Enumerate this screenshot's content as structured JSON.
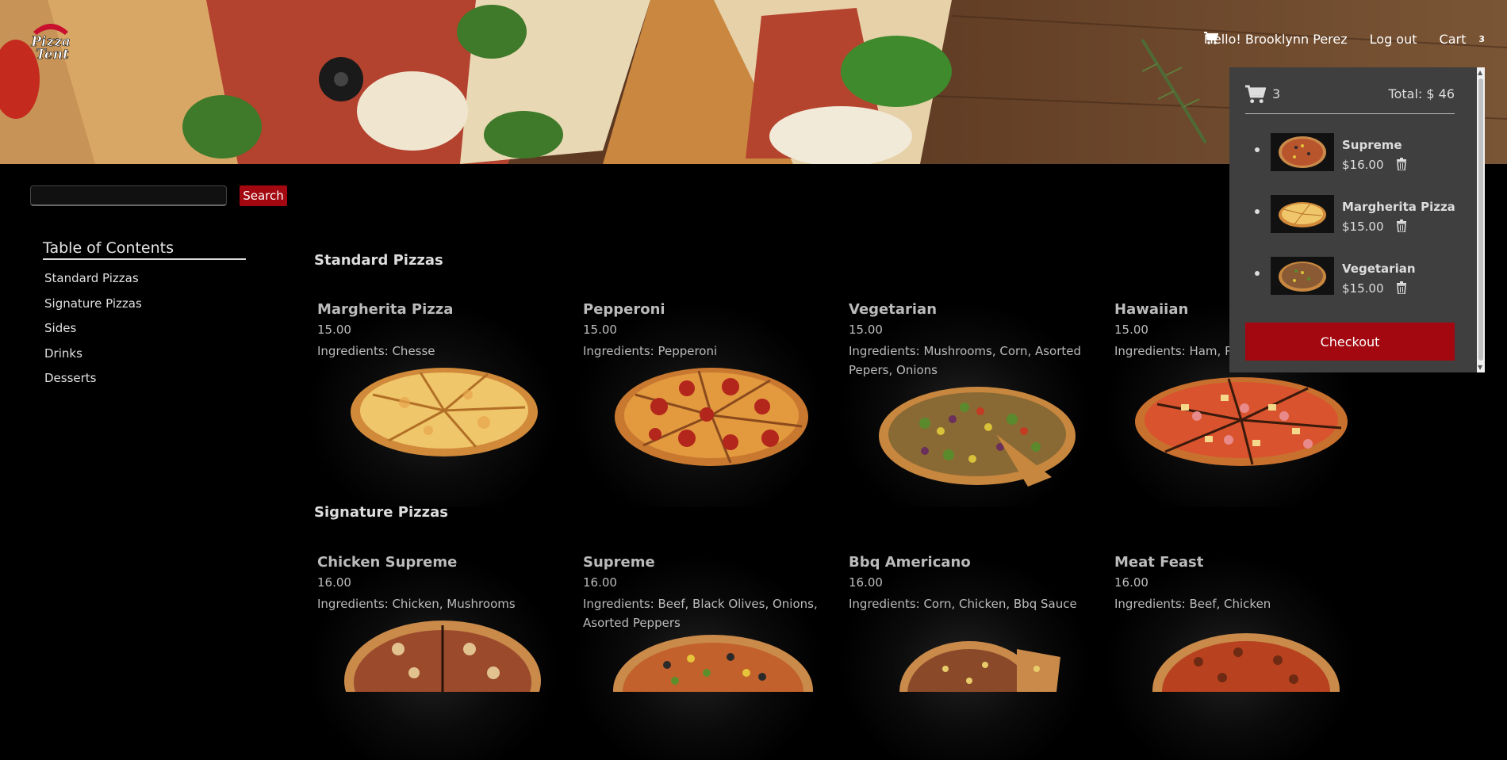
{
  "header": {
    "greeting": "Hello! Brooklynn Perez",
    "logout_label": "Log out",
    "cart_label": "Cart",
    "cart_count": "3",
    "logo_text_1": "Pizza",
    "logo_text_2": "Tent",
    "cart_icon": "cart-icon"
  },
  "search": {
    "placeholder": "",
    "value": "",
    "button_label": "Search"
  },
  "toc": {
    "title": "Table of Contents",
    "items": [
      "Standard Pizzas",
      "Signature Pizzas",
      "Sides",
      "Drinks",
      "Desserts"
    ]
  },
  "menu": {
    "standard": {
      "title": "Standard Pizzas",
      "items": [
        {
          "name": "Margherita Pizza",
          "price": "15.00",
          "ingredients": "Ingredients: Chesse"
        },
        {
          "name": "Pepperoni",
          "price": "15.00",
          "ingredients": "Ingredients: Pepperoni"
        },
        {
          "name": "Vegetarian",
          "price": "15.00",
          "ingredients": "Ingredients: Mushrooms, Corn, Asorted Pepers, Onions"
        },
        {
          "name": "Hawaiian",
          "price": "15.00",
          "ingredients": "Ingredients: Ham, Pi"
        }
      ]
    },
    "signature": {
      "title": "Signature Pizzas",
      "items": [
        {
          "name": "Chicken Supreme",
          "price": "16.00",
          "ingredients": "Ingredients: Chicken, Mushrooms"
        },
        {
          "name": "Supreme",
          "price": "16.00",
          "ingredients": "Ingredients: Beef, Black Olives, Onions, Asorted Peppers"
        },
        {
          "name": "Bbq Americano",
          "price": "16.00",
          "ingredients": "Ingredients: Corn, Chicken, Bbq Sauce"
        },
        {
          "name": "Meat Feast",
          "price": "16.00",
          "ingredients": "Ingredients: Beef, Chicken"
        }
      ]
    }
  },
  "cart": {
    "count": "3",
    "total": "Total: $ 46",
    "items": [
      {
        "name": "Supreme",
        "price": "$16.00"
      },
      {
        "name": "Margherita Pizza",
        "price": "$15.00"
      },
      {
        "name": "Vegetarian",
        "price": "$15.00"
      }
    ],
    "checkout_label": "Checkout"
  },
  "colors": {
    "accent": "#a3070f",
    "background": "#000000",
    "popup": "#3f3f3f"
  }
}
